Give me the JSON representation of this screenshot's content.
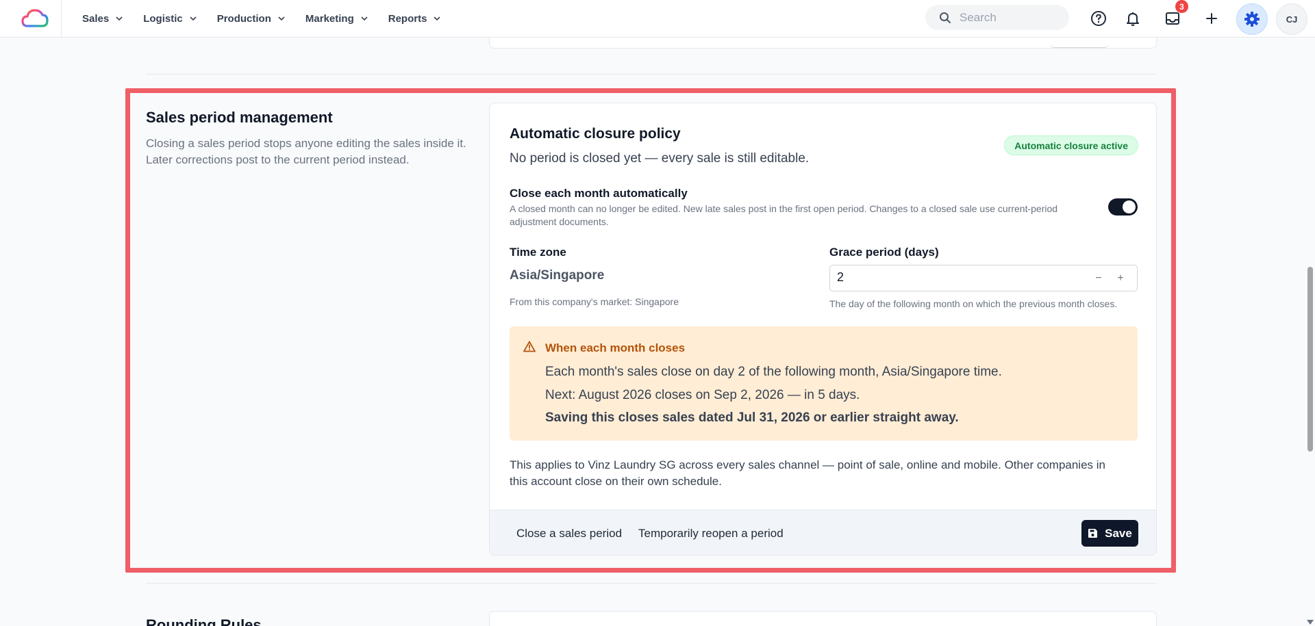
{
  "nav": {
    "items": [
      {
        "label": "Sales"
      },
      {
        "label": "Logistic"
      },
      {
        "label": "Production"
      },
      {
        "label": "Marketing"
      },
      {
        "label": "Reports"
      }
    ],
    "search_placeholder": "Search",
    "inbox_badge": "3",
    "avatar_initials": "CJ"
  },
  "section": {
    "title": "Sales period management",
    "description": "Closing a sales period stops anyone editing the sales inside it. Later corrections post to the current period instead."
  },
  "card": {
    "title": "Automatic closure policy",
    "status_text": "No period is closed yet — every sale is still editable.",
    "status_pill": "Automatic closure active",
    "toggle": {
      "label": "Close each month automatically",
      "description": "A closed month can no longer be edited. New late sales post in the first open period. Changes to a closed sale use current-period adjustment documents.",
      "on": true
    },
    "timezone": {
      "label": "Time zone",
      "value": "Asia/Singapore",
      "helper": "From this company's market: Singapore"
    },
    "grace": {
      "label": "Grace period (days)",
      "value": "2",
      "helper": "The day of the following month on which the previous month closes.",
      "decrement": "−",
      "increment": "+"
    },
    "callout": {
      "title": "When each month closes",
      "line1": "Each month's sales close on day 2 of the following month, Asia/Singapore time.",
      "line2": "Next: August 2026 closes on Sep 2, 2026 — in 5 days.",
      "line3": "Saving this closes sales dated Jul 31, 2026 or earlier straight away."
    },
    "applies": "This applies to Vinz Laundry SG across every sales channel — point of sale, online and mobile. Other companies in this account close on their own schedule.",
    "footer": {
      "close_link": "Close a sales period",
      "reopen_link": "Temporarily reopen a period",
      "save_label": "Save"
    }
  },
  "next_section": {
    "title": "Rounding Rules"
  },
  "colors": {
    "highlight": "#ef5f67",
    "primary_dark": "#0f172a",
    "success": "#15803d",
    "warning": "#b45309",
    "warning_bg": "#ffedd5",
    "gear_bg": "#dbeafe"
  }
}
